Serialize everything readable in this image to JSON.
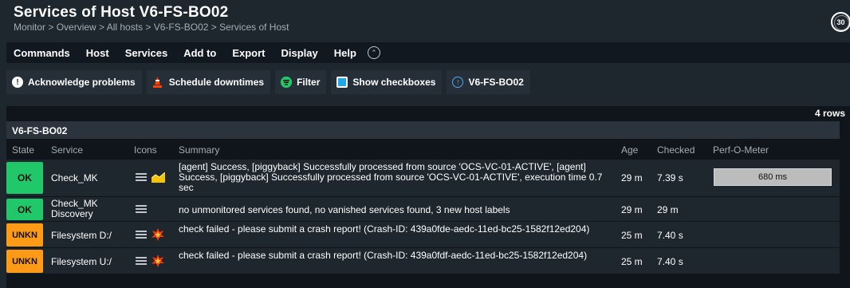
{
  "header": {
    "title": "Services of Host V6-FS-BO02",
    "breadcrumb": "Monitor > Overview > All hosts > V6-FS-BO02 > Services of Host",
    "refresh_seconds": "30"
  },
  "menu": [
    "Commands",
    "Host",
    "Services",
    "Add to",
    "Export",
    "Display",
    "Help"
  ],
  "shortcuts": {
    "acknowledge": "Acknowledge problems",
    "schedule": "Schedule downtimes",
    "filter": "Filter",
    "checkboxes": "Show checkboxes",
    "host": "V6-FS-BO02"
  },
  "table": {
    "rows_count": "4 rows",
    "host_group": "V6-FS-BO02",
    "columns": [
      "State",
      "Service",
      "Icons",
      "Summary",
      "Age",
      "Checked",
      "Perf-O-Meter"
    ],
    "rows": [
      {
        "state": "OK",
        "service": "Check_MK",
        "summary": "[agent] Success, [piggyback] Successfully processed from source 'OCS-VC-01-ACTIVE', [agent] Success, [piggyback] Successfully processed from source 'OCS-VC-01-ACTIVE', execution time 0.7 sec",
        "age": "29 m",
        "checked": "7.39 s",
        "perf": "680 ms"
      },
      {
        "state": "OK",
        "service": "Check_MK Discovery",
        "summary": "no unmonitored services found, no vanished services found, 3 new host labels",
        "age": "29 m",
        "checked": "29 m",
        "perf": ""
      },
      {
        "state": "UNKN",
        "service": "Filesystem D:/",
        "summary": "check failed - please submit a crash report! (Crash-ID: 439a0fde-aedc-11ed-bc25-1582f12ed204)",
        "age": "25 m",
        "checked": "7.40 s",
        "perf": ""
      },
      {
        "state": "UNKN",
        "service": "Filesystem U:/",
        "summary": "check failed - please submit a crash report! (Crash-ID: 439a0fdf-aedc-11ed-bc25-1582f12ed204)",
        "age": "25 m",
        "checked": "7.40 s",
        "perf": ""
      }
    ]
  },
  "colors": {
    "ok": "#21c86a",
    "unknown": "#ff9a16",
    "background": "#1e262e"
  }
}
